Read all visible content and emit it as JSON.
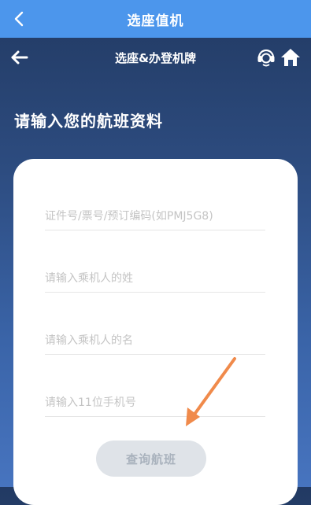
{
  "topbar": {
    "title": "选座值机",
    "back_icon": "chevron-left-icon"
  },
  "navbar": {
    "title": "选座&办登机牌",
    "back_icon": "arrow-left-icon",
    "right_icons": [
      "customer-service-icon",
      "home-icon"
    ]
  },
  "heading": "请输入您的航班资料",
  "form": {
    "fields": [
      {
        "placeholder": "证件号/票号/预订编码(如PMJ5G8)",
        "value": ""
      },
      {
        "placeholder": "请输入乘机人的姓",
        "value": ""
      },
      {
        "placeholder": "请输入乘机人的名",
        "value": ""
      },
      {
        "placeholder": "请输入11位手机号",
        "value": ""
      }
    ],
    "submit_label": "查询航班"
  },
  "colors": {
    "topbar": "#4c96ec",
    "background_top": "#223a63",
    "background_bottom": "#4774bf",
    "annotation_arrow": "#f08a4b",
    "button_disabled": "#dfe3e8"
  }
}
